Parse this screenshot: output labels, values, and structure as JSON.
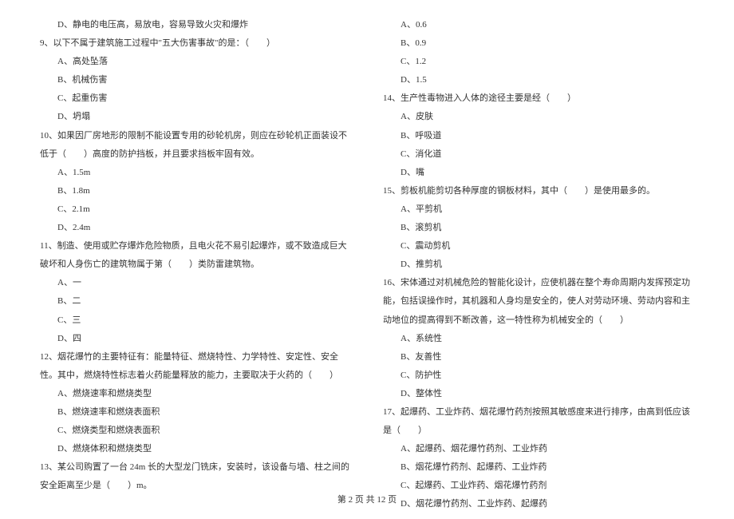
{
  "left": {
    "l0": "D、静电的电压高，易放电，容易导致火灾和爆炸",
    "q9": "9、以下不属于建筑施工过程中\"五大伤害事故\"的是：（　　）",
    "q9a": "A、高处坠落",
    "q9b": "B、机械伤害",
    "q9c": "C、起重伤害",
    "q9d": "D、坍塌",
    "q10": "10、如果因厂房地形的限制不能设置专用的砂轮机房，则应在砂轮机正面装设不低于（　　）高度的防护挡板，并且要求挡板牢固有效。",
    "q10a": "A、1.5m",
    "q10b": "B、1.8m",
    "q10c": "C、2.1m",
    "q10d": "D、2.4m",
    "q11": "11、制造、使用或贮存爆炸危险物质，且电火花不易引起爆炸，或不致造成巨大破坏和人身伤亡的建筑物属于第（　　）类防雷建筑物。",
    "q11a": "A、一",
    "q11b": "B、二",
    "q11c": "C、三",
    "q11d": "D、四",
    "q12": "12、烟花爆竹的主要特征有：能量特征、燃烧特性、力学特性、安定性、安全性。其中，燃烧特性标志着火药能量释放的能力，主要取决于火药的（　　）",
    "q12a": "A、燃烧速率和燃烧类型",
    "q12b": "B、燃烧速率和燃烧表面积",
    "q12c": "C、燃烧类型和燃烧表面积",
    "q12d": "D、燃烧体积和燃烧类型",
    "q13": "13、某公司购置了一台 24m 长的大型龙门铣床，安装时，该设备与墙、柱之间的安全距离至少是（　　）m。"
  },
  "right": {
    "r1": "A、0.6",
    "r2": "B、0.9",
    "r3": "C、1.2",
    "r4": "D、1.5",
    "q14": "14、生产性毒物进入人体的途径主要是经（　　）",
    "q14a": "A、皮肤",
    "q14b": "B、呼吸道",
    "q14c": "C、消化道",
    "q14d": "D、嘴",
    "q15": "15、剪板机能剪切各种厚度的钢板材料，其中（　　）是使用最多的。",
    "q15a": "A、平剪机",
    "q15b": "B、滚剪机",
    "q15c": "C、震动剪机",
    "q15d": "D、推剪机",
    "q16": "16、宋体通过对机械危险的智能化设计，应使机器在整个寿命周期内发挥预定功能，包括误操作时，其机器和人身均是安全的，使人对劳动环境、劳动内容和主动地位的提高得到不断改善，这一特性称为机械安全的（　　）",
    "q16a": "A、系统性",
    "q16b": "B、友善性",
    "q16c": "C、防护性",
    "q16d": "D、整体性",
    "q17": "17、起爆药、工业炸药、烟花爆竹药剂按照其敏感度来进行排序，由高到低应该是（　　）",
    "q17a": "A、起爆药、烟花爆竹药剂、工业炸药",
    "q17b": "B、烟花爆竹药剂、起爆药、工业炸药",
    "q17c": "C、起爆药、工业炸药、烟花爆竹药剂",
    "q17d": "D、烟花爆竹药剂、工业炸药、起爆药"
  },
  "footer": "第 2 页 共 12 页"
}
